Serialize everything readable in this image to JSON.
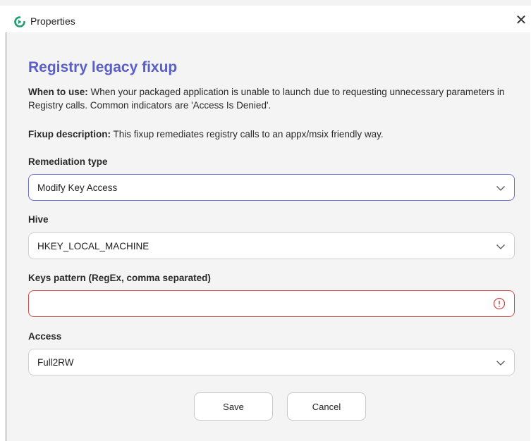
{
  "window": {
    "title": "Properties",
    "icon": "app-logo-icon",
    "close_glyph": "✕"
  },
  "page": {
    "heading": "Registry legacy fixup",
    "when_label": "When to use:",
    "when_text": " When your packaged application is unable to launch due to requesting unnecessary parameters in Registry calls. Common indicators are 'Access Is Denied'.",
    "desc_label": "Fixup description:",
    "desc_text": " This fixup remediates registry calls to an appx/msix friendly way."
  },
  "form": {
    "remediation": {
      "label": "Remediation type",
      "value": "Modify Key Access"
    },
    "hive": {
      "label": "Hive",
      "value": "HKEY_LOCAL_MACHINE"
    },
    "keys": {
      "label": "Keys pattern (RegEx, comma separated)",
      "value": ""
    },
    "access": {
      "label": "Access",
      "value": "Full2RW"
    }
  },
  "buttons": {
    "save": "Save",
    "cancel": "Cancel"
  },
  "colors": {
    "heading": "#5a5fc8",
    "focus_border": "#6b6fd1",
    "error": "#d24b4b",
    "icon_green": "#1e9e6a"
  }
}
